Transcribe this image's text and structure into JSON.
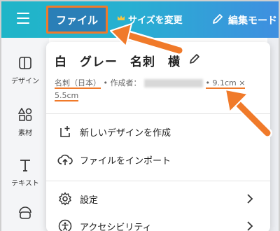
{
  "topbar": {
    "file_label": "ファイル",
    "resize_label": "サイズを変更",
    "edit_mode_label": "編集モード"
  },
  "sidebar": {
    "items": [
      {
        "label": "デザイン"
      },
      {
        "label": "素材"
      },
      {
        "label": "テキスト"
      }
    ]
  },
  "panel": {
    "title": "白　グレー　名刺　横",
    "meta_type": "名刺（日本）",
    "meta_author_prefix": "• 作成者：",
    "meta_size_w": "• 9.1cm ×",
    "meta_size_h": "5.5cm",
    "menu": [
      {
        "label": "新しいデザインを作成"
      },
      {
        "label": "ファイルをインポート"
      },
      {
        "label": "設定"
      },
      {
        "label": "アクセシビリティ"
      }
    ]
  },
  "colors": {
    "accent_orange": "#f07a2a",
    "topbar_start": "#1fb5c8",
    "topbar_end": "#3f8fe0"
  }
}
